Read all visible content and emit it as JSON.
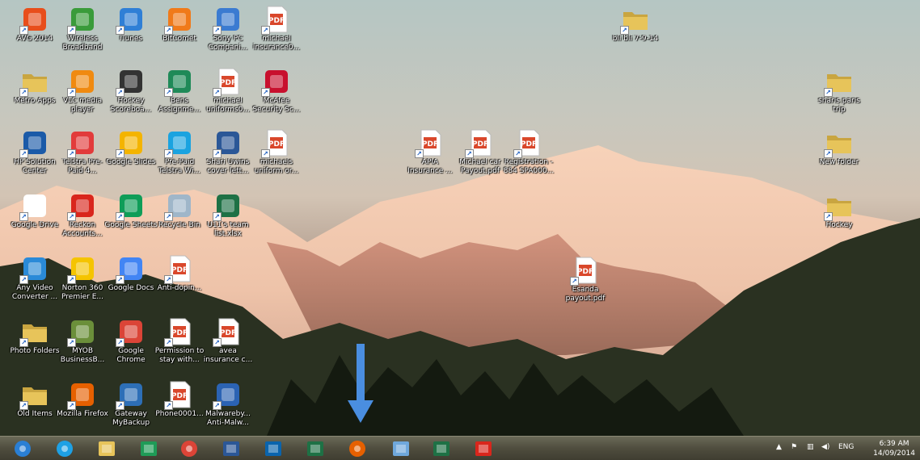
{
  "desktop": {
    "icons": [
      {
        "label": "AVG 2014",
        "icon": "avg-icon",
        "color": "#e84e1b"
      },
      {
        "label": "Wireless Broadband",
        "icon": "wireless-broadband-icon",
        "color": "#3a9b3a"
      },
      {
        "label": "iTunes",
        "icon": "itunes-icon",
        "color": "#2f7fd6"
      },
      {
        "label": "BitComet",
        "icon": "bitcomet-icon",
        "color": "#f07a1a"
      },
      {
        "label": "Sony PC Compani...",
        "icon": "sony-pc-companion-icon",
        "color": "#3b7bd1"
      },
      {
        "label": "michael insurance0...",
        "icon": "pdf-icon",
        "color": "#d9472b"
      },
      {
        "label": "Metro Apps",
        "icon": "folder-icon",
        "color": "#e7c45a"
      },
      {
        "label": "VLC media player",
        "icon": "vlc-icon",
        "color": "#f08a10"
      },
      {
        "label": "Hockey Scoreboa...",
        "icon": "hockey-scoreboard-icon",
        "color": "#333333"
      },
      {
        "label": "Bens Assignme...",
        "icon": "publisher-icon",
        "color": "#1f8a58"
      },
      {
        "label": "michael uniforms0...",
        "icon": "pdf-icon",
        "color": "#d9472b"
      },
      {
        "label": "McAfee Security Sc...",
        "icon": "mcafee-icon",
        "color": "#c8102e"
      },
      {
        "label": "HP Solution Center",
        "icon": "hp-icon",
        "color": "#1b5aa8"
      },
      {
        "label": "Telstra Pre-Paid 4...",
        "icon": "telstra-icon",
        "color": "#e23b3b"
      },
      {
        "label": "Google Slides",
        "icon": "google-slides-icon",
        "color": "#f4b400"
      },
      {
        "label": "Pre-Paid Telstra Wi...",
        "icon": "telstra-4g-icon",
        "color": "#1aa3e0"
      },
      {
        "label": "Shari Uwins cover lett...",
        "icon": "word-doc-icon",
        "color": "#2b5797"
      },
      {
        "label": "michaels uniform or...",
        "icon": "pdf-icon",
        "color": "#d9472b"
      },
      {
        "label": "Google Drive",
        "icon": "google-drive-icon",
        "color": "#ffffff"
      },
      {
        "label": "Reckon Accounts...",
        "icon": "reckon-icon",
        "color": "#d9261c"
      },
      {
        "label": "Google Sheets",
        "icon": "google-sheets-icon",
        "color": "#0f9d58"
      },
      {
        "label": "Recycle Bin",
        "icon": "recycle-bin-icon",
        "color": "#9fb6c9"
      },
      {
        "label": "U11's team list.xlsx",
        "icon": "excel-doc-icon",
        "color": "#1e7145"
      },
      {
        "label": "Any Video Converter ...",
        "icon": "any-video-converter-icon",
        "color": "#2a8ad8"
      },
      {
        "label": "Norton 360 Premier E...",
        "icon": "norton-icon",
        "color": "#f5c400"
      },
      {
        "label": "Google Docs",
        "icon": "google-docs-icon",
        "color": "#4285f4"
      },
      {
        "label": "Anti-dopin...",
        "icon": "pdf-icon",
        "color": "#d9472b"
      },
      {
        "label": "Photo Folders",
        "icon": "folder-icon",
        "color": "#e7c45a"
      },
      {
        "label": "MYOB BusinessB...",
        "icon": "myob-icon",
        "color": "#6b8f3a"
      },
      {
        "label": "Google Chrome",
        "icon": "chrome-icon",
        "color": "#db4437"
      },
      {
        "label": "Permission to stay with...",
        "icon": "pdf-icon",
        "color": "#d9472b"
      },
      {
        "label": "avea insurance c...",
        "icon": "pdf-icon",
        "color": "#d9472b"
      },
      {
        "label": "Old Items",
        "icon": "folder-icon",
        "color": "#e7c45a"
      },
      {
        "label": "Mozilla Firefox",
        "icon": "firefox-icon",
        "color": "#e66000"
      },
      {
        "label": "Gateway MyBackup",
        "icon": "mybackup-icon",
        "color": "#2d6fb7"
      },
      {
        "label": "Phone0001...",
        "icon": "pdf-icon",
        "color": "#d9472b"
      },
      {
        "label": "Malwareby... Anti-Malw...",
        "icon": "malwarebytes-icon",
        "color": "#2b63b3"
      },
      {
        "label": "APIA Insurance ...",
        "icon": "pdf-icon",
        "color": "#d9472b"
      },
      {
        "label": "Michael car Payout.pdf",
        "icon": "pdf-icon",
        "color": "#d9472b"
      },
      {
        "label": "Registration - 884 SPA000...",
        "icon": "pdf-icon",
        "color": "#d9472b"
      },
      {
        "label": "Esanda payout.pdf",
        "icon": "pdf-icon",
        "color": "#d9472b"
      },
      {
        "label": "bli bli 7-9-14",
        "icon": "folder-icon",
        "color": "#e7c45a"
      },
      {
        "label": "sharis paris trip",
        "icon": "folder-icon",
        "color": "#e7c45a"
      },
      {
        "label": "New folder",
        "icon": "folder-icon",
        "color": "#e7c45a"
      },
      {
        "label": "Hockey",
        "icon": "folder-icon",
        "color": "#e7c45a"
      }
    ]
  },
  "taskbar": {
    "buttons": [
      {
        "icon": "start-orb-icon",
        "color": "#2a7fd4"
      },
      {
        "icon": "internet-explorer-icon",
        "color": "#1ea1e5"
      },
      {
        "icon": "file-explorer-icon",
        "color": "#e7c45a"
      },
      {
        "icon": "store-icon",
        "color": "#1f9b57"
      },
      {
        "icon": "chrome-icon",
        "color": "#db4437"
      },
      {
        "icon": "word-icon",
        "color": "#2b5797"
      },
      {
        "icon": "outlook-icon",
        "color": "#0a64ad"
      },
      {
        "icon": "excel-icon",
        "color": "#1e7145"
      },
      {
        "icon": "firefox-icon",
        "color": "#e66000"
      },
      {
        "icon": "calculator-icon",
        "color": "#6fa8dc"
      },
      {
        "icon": "excel-icon",
        "color": "#1e7145"
      },
      {
        "icon": "reckon-icon",
        "color": "#d9261c"
      }
    ],
    "tray": {
      "expand": "▲",
      "language": "ENG",
      "time": "6:39 AM",
      "date": "14/09/2014"
    }
  },
  "annotation": {
    "arrow_color": "#4a8ee0",
    "points_to": "firefox-taskbar-button"
  }
}
